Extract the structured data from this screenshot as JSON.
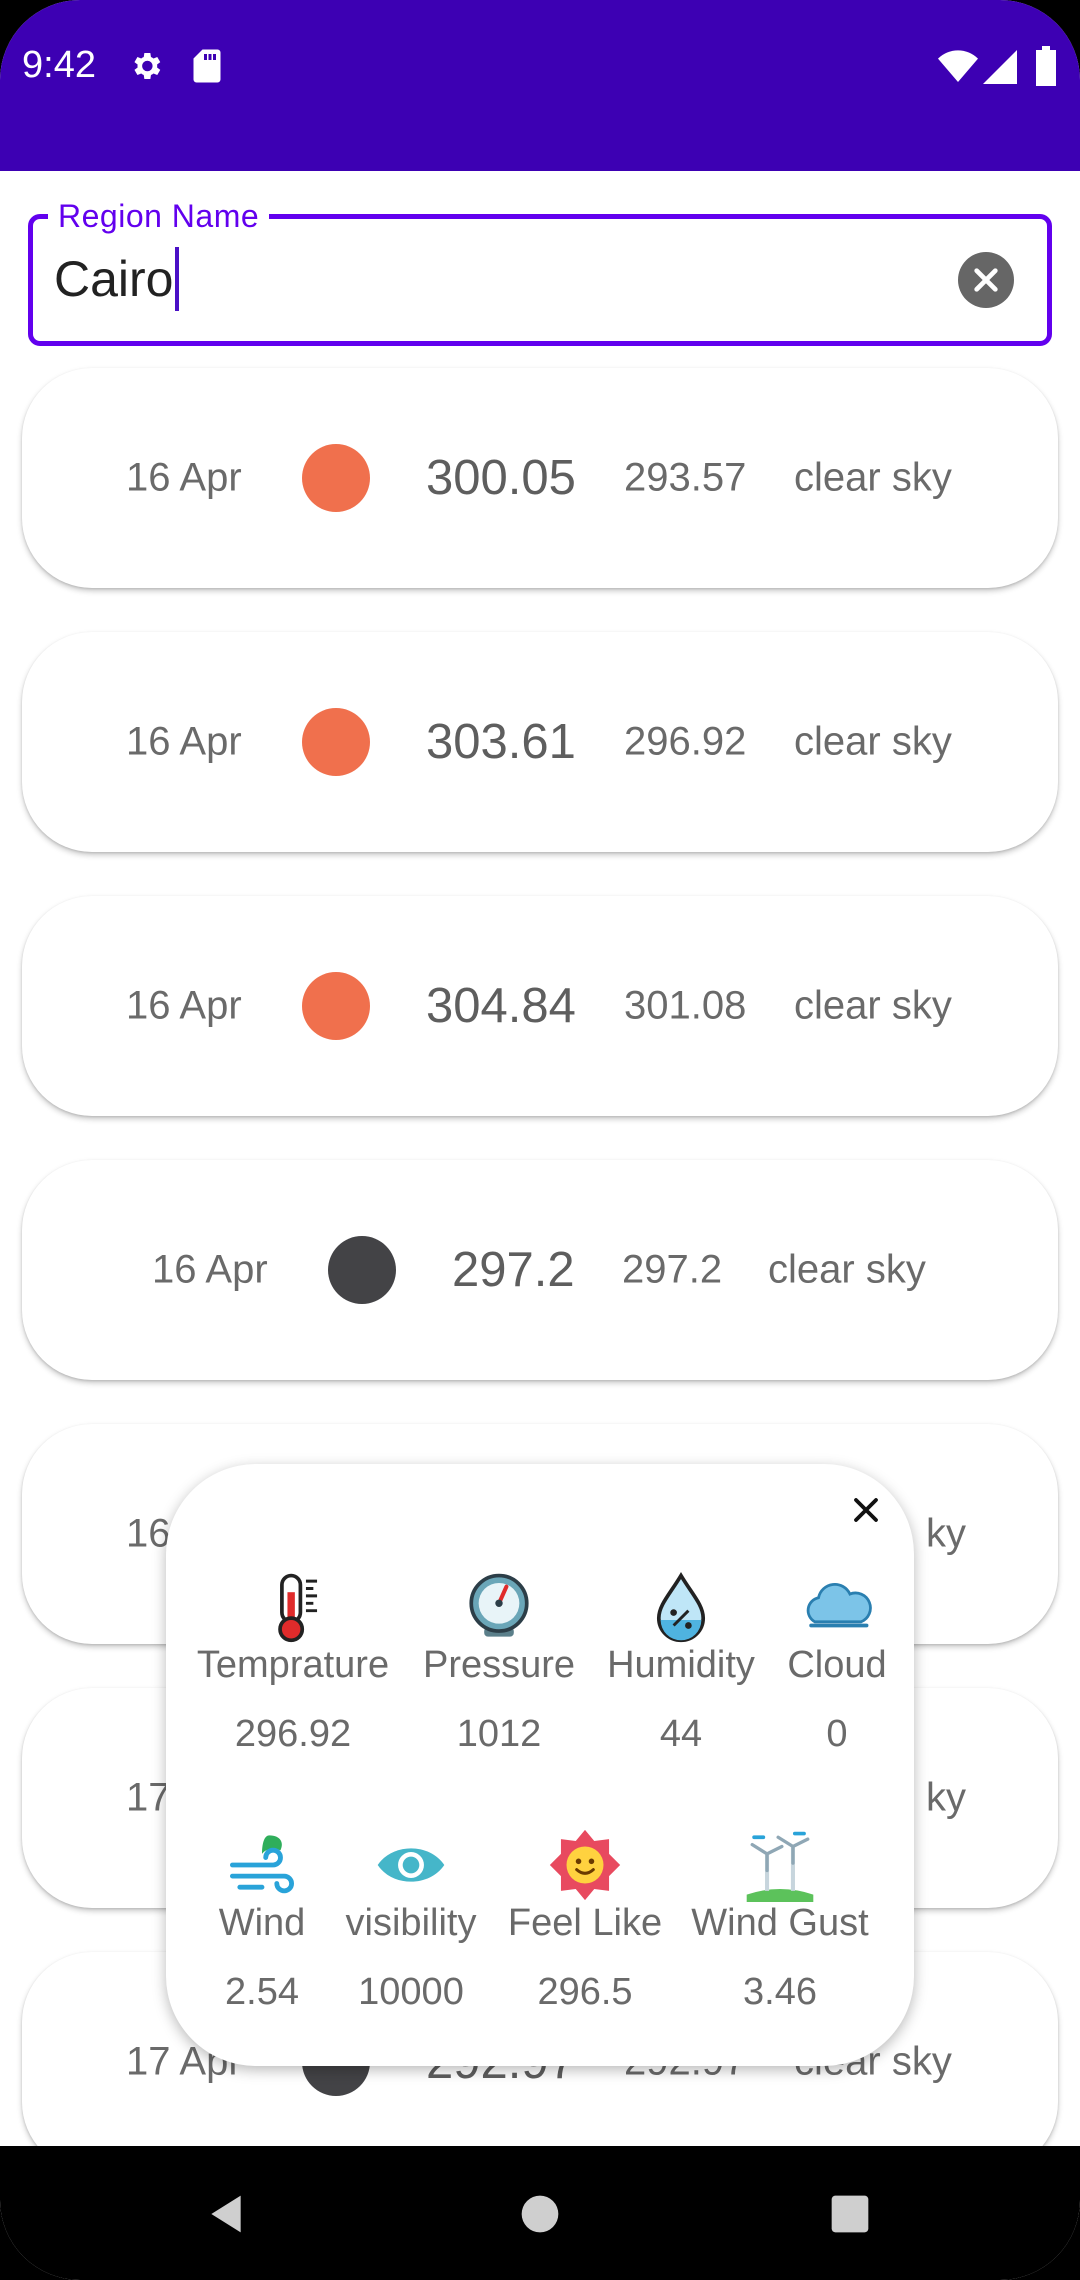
{
  "status_bar": {
    "time": "9:42"
  },
  "search": {
    "label": "Region Name",
    "value": "Cairo"
  },
  "forecast": [
    {
      "date": "16 Apr",
      "dot_color": "#f0704d",
      "temp": "300.05",
      "min": "293.57",
      "desc": "clear sky"
    },
    {
      "date": "16 Apr",
      "dot_color": "#f0704d",
      "temp": "303.61",
      "min": "296.92",
      "desc": "clear sky"
    },
    {
      "date": "16 Apr",
      "dot_color": "#f0704d",
      "temp": "304.84",
      "min": "301.08",
      "desc": "clear sky"
    },
    {
      "date": "16 Apr",
      "dot_color": "#434346",
      "temp": "297.2",
      "min": "297.2",
      "desc": "clear sky"
    },
    {
      "date": "16",
      "desc": "ky"
    },
    {
      "date": "17",
      "desc": "ky"
    },
    {
      "date": "17 Apr",
      "dot_color": "#434346",
      "temp": "292.97",
      "min": "292.97",
      "desc": "clear sky"
    }
  ],
  "details": {
    "metrics": [
      {
        "icon": "thermometer-icon",
        "label": "Temprature",
        "value": "296.92"
      },
      {
        "icon": "pressure-gauge-icon",
        "label": "Pressure",
        "value": "1012"
      },
      {
        "icon": "humidity-drop-icon",
        "label": "Humidity",
        "value": "44"
      },
      {
        "icon": "cloud-icon",
        "label": "Cloud",
        "value": "0"
      },
      {
        "icon": "wind-icon",
        "label": "Wind",
        "value": "2.54"
      },
      {
        "icon": "eye-icon",
        "label": "visibility",
        "value": "10000"
      },
      {
        "icon": "smiley-sun-icon",
        "label": "Feel Like",
        "value": "296.5"
      },
      {
        "icon": "wind-turbine-icon",
        "label": "Wind Gust",
        "value": "3.46"
      }
    ]
  },
  "colors": {
    "status_bar": "#3d00b3",
    "accent": "#6200ee",
    "hot_dot": "#f0704d",
    "night_dot": "#434346"
  }
}
